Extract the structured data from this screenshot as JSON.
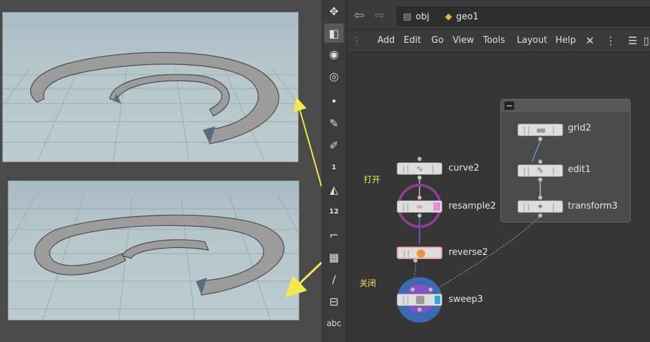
{
  "path_bar": {
    "crumbs": [
      "obj",
      "geo1"
    ]
  },
  "menu": {
    "items": [
      "Add",
      "Edit",
      "Go",
      "View",
      "Tools",
      "Layout",
      "Help"
    ]
  },
  "shelf": {
    "tool_labels": [
      "1",
      "12",
      "abc"
    ]
  },
  "nodes": {
    "curve": "curve2",
    "resample": "resample2",
    "reverse": "reverse2",
    "sweep": "sweep3",
    "grid": "grid2",
    "edit": "edit1",
    "transform": "transform3"
  },
  "annotations": {
    "open": "打开",
    "close": "关闭"
  },
  "colors": {
    "annotation": "#f2e94e",
    "resample_flag": "#e48cd6",
    "sweep_flag": "#29a8e0",
    "sweep_ring": "#3a6bb0",
    "resample_ring": "#8a3f8f"
  }
}
